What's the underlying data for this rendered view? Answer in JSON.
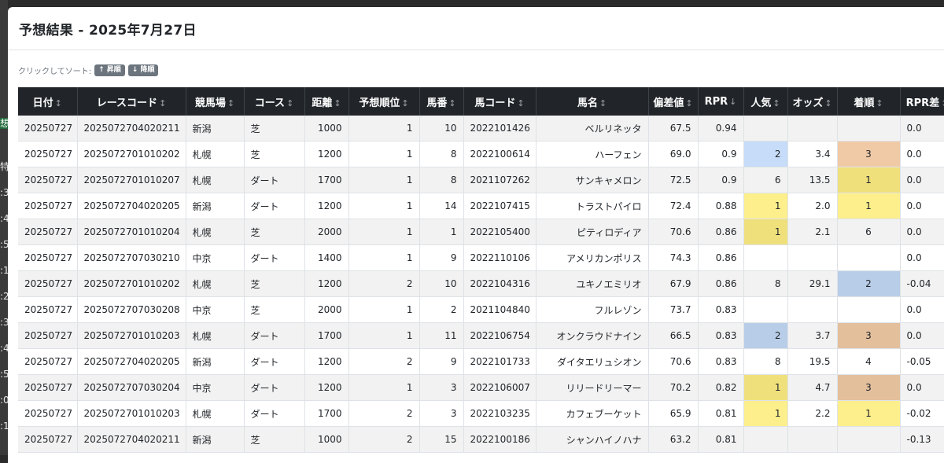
{
  "modal": {
    "title": "予想結果 - 2025年7月27日"
  },
  "sort_bar": {
    "hint": "クリックしてソート:",
    "asc_label": "↑ 昇順",
    "desc_label": "↓ 降順"
  },
  "background_glyphs": [
    "想",
    "特",
    ":3",
    ":4",
    ":5",
    ":1",
    ":2",
    ":3",
    ":4",
    ":5",
    ":0",
    ":1"
  ],
  "table": {
    "headers": [
      "日付",
      "レースコード",
      "競馬場",
      "コース",
      "距離",
      "予想順位",
      "馬番",
      "馬コード",
      "馬名",
      "偏差値",
      "RPR",
      "人気",
      "オッズ",
      "着順",
      "RPR差"
    ],
    "rows": [
      [
        "20250727",
        "2025072704020211",
        "新潟",
        "芝",
        "1000",
        "1",
        "10",
        "2022101426",
        "ベルリネッタ",
        "67.5",
        "0.94",
        "",
        "",
        "",
        "0.0"
      ],
      [
        "20250727",
        "2025072701010202",
        "札幌",
        "芝",
        "1200",
        "1",
        "8",
        "2022100614",
        "ハーフェン",
        "69.0",
        "0.9",
        "2",
        "3.4",
        "3",
        "0.0"
      ],
      [
        "20250727",
        "2025072701010207",
        "札幌",
        "ダート",
        "1700",
        "1",
        "8",
        "2021107262",
        "サンキャメロン",
        "72.5",
        "0.9",
        "6",
        "13.5",
        "1",
        "0.0"
      ],
      [
        "20250727",
        "2025072704020205",
        "新潟",
        "ダート",
        "1200",
        "1",
        "14",
        "2022107415",
        "トラストパイロ",
        "72.4",
        "0.88",
        "1",
        "2.0",
        "1",
        "0.0"
      ],
      [
        "20250727",
        "2025072701010204",
        "札幌",
        "芝",
        "2000",
        "1",
        "1",
        "2022105400",
        "ピティロディア",
        "70.6",
        "0.86",
        "1",
        "2.1",
        "6",
        "0.0"
      ],
      [
        "20250727",
        "2025072707030210",
        "中京",
        "ダート",
        "1400",
        "1",
        "9",
        "2022110106",
        "アメリカンポリス",
        "74.3",
        "0.86",
        "",
        "",
        "",
        "0.0"
      ],
      [
        "20250727",
        "2025072701010202",
        "札幌",
        "芝",
        "1200",
        "2",
        "10",
        "2022104316",
        "ユキノエミリオ",
        "67.9",
        "0.86",
        "8",
        "29.1",
        "2",
        "-0.04"
      ],
      [
        "20250727",
        "2025072707030208",
        "中京",
        "芝",
        "2000",
        "1",
        "2",
        "2021104840",
        "フルレゾン",
        "73.7",
        "0.83",
        "",
        "",
        "",
        "0.0"
      ],
      [
        "20250727",
        "2025072701010203",
        "札幌",
        "ダート",
        "1700",
        "1",
        "11",
        "2022106754",
        "オンクラウドナイン",
        "66.5",
        "0.83",
        "2",
        "3.7",
        "3",
        "0.0"
      ],
      [
        "20250727",
        "2025072704020205",
        "新潟",
        "ダート",
        "1200",
        "2",
        "9",
        "2022101733",
        "ダイタエリュシオン",
        "70.6",
        "0.83",
        "8",
        "19.5",
        "4",
        "-0.05"
      ],
      [
        "20250727",
        "2025072707030204",
        "中京",
        "ダート",
        "1200",
        "1",
        "3",
        "2022106007",
        "リリードリーマー",
        "70.2",
        "0.82",
        "1",
        "4.7",
        "3",
        "0.0"
      ],
      [
        "20250727",
        "2025072701010203",
        "札幌",
        "ダート",
        "1700",
        "2",
        "3",
        "2022103235",
        "カフェブーケット",
        "65.9",
        "0.81",
        "1",
        "2.2",
        "1",
        "-0.02"
      ],
      [
        "20250727",
        "2025072704020211",
        "新潟",
        "芝",
        "1000",
        "2",
        "15",
        "2022100186",
        "シャンハイノハナ",
        "63.2",
        "0.81",
        "",
        "",
        "",
        "-0.13"
      ]
    ],
    "highlights": {
      "popularity": [
        "",
        "blue",
        "",
        "yellow",
        "yellow",
        "",
        "",
        "",
        "blue",
        "",
        "yellow",
        "yellow",
        ""
      ],
      "finish": [
        "",
        "orange",
        "yellow",
        "yellow",
        "",
        "",
        "blue",
        "",
        "orange",
        "",
        "orange",
        "yellow",
        ""
      ]
    }
  }
}
